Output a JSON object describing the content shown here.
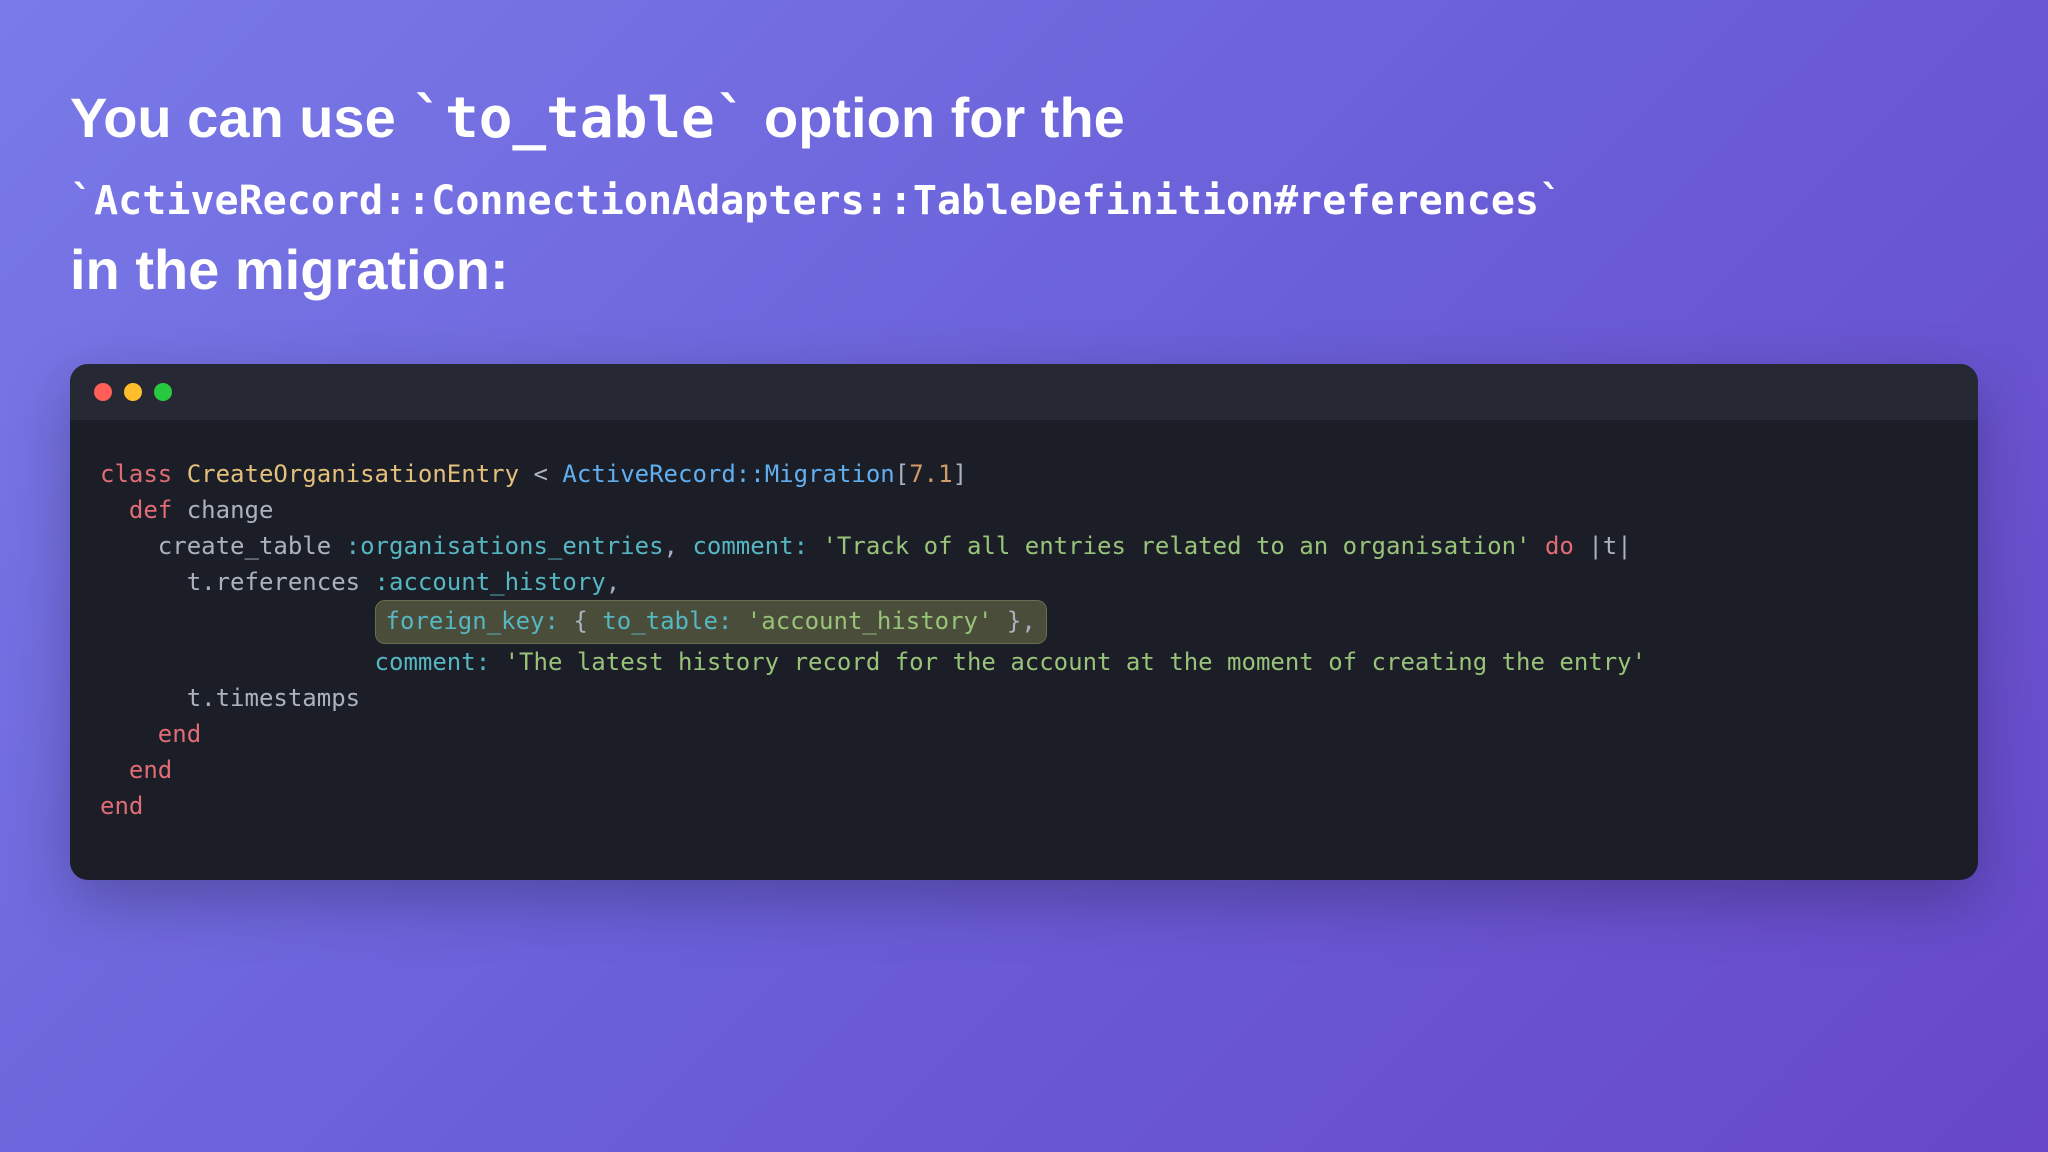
{
  "heading": {
    "part1": "You can use ",
    "code1": "`to_table`",
    "part2": " option for the ",
    "code2": "`ActiveRecord::ConnectionAdapters::TableDefinition#references`",
    "part3": " in the migration:"
  },
  "titlebar": {
    "dots": [
      "red",
      "yellow",
      "green"
    ]
  },
  "code": {
    "line1": {
      "kw_class": "class",
      "class_name": "CreateOrganisationEntry",
      "lt": "<",
      "const": "ActiveRecord::Migration",
      "bracket_open": "[",
      "version": "7.1",
      "bracket_close": "]"
    },
    "line2": {
      "kw_def": "def",
      "method_name": "change"
    },
    "line3": {
      "call": "create_table",
      "sym": ":organisations_entries",
      "comma1": ",",
      "key": "comment:",
      "str": "'Track of all entries related to an organisation'",
      "kw_do": "do",
      "pipe_open": "|",
      "param": "t",
      "pipe_close": "|"
    },
    "line4": {
      "call": "t.references",
      "sym": ":account_history",
      "comma": ","
    },
    "line5": {
      "key_fk": "foreign_key:",
      "brace_open": "{",
      "key_tt": "to_table:",
      "str": "'account_history'",
      "brace_close": "}",
      "comma": ","
    },
    "line6": {
      "key": "comment:",
      "str": "'The latest history record for the account at the moment of creating the entry'"
    },
    "line7": {
      "call": "t.timestamps"
    },
    "line8": {
      "kw_end": "end"
    },
    "line9": {
      "kw_end": "end"
    },
    "line10": {
      "kw_end": "end"
    }
  }
}
